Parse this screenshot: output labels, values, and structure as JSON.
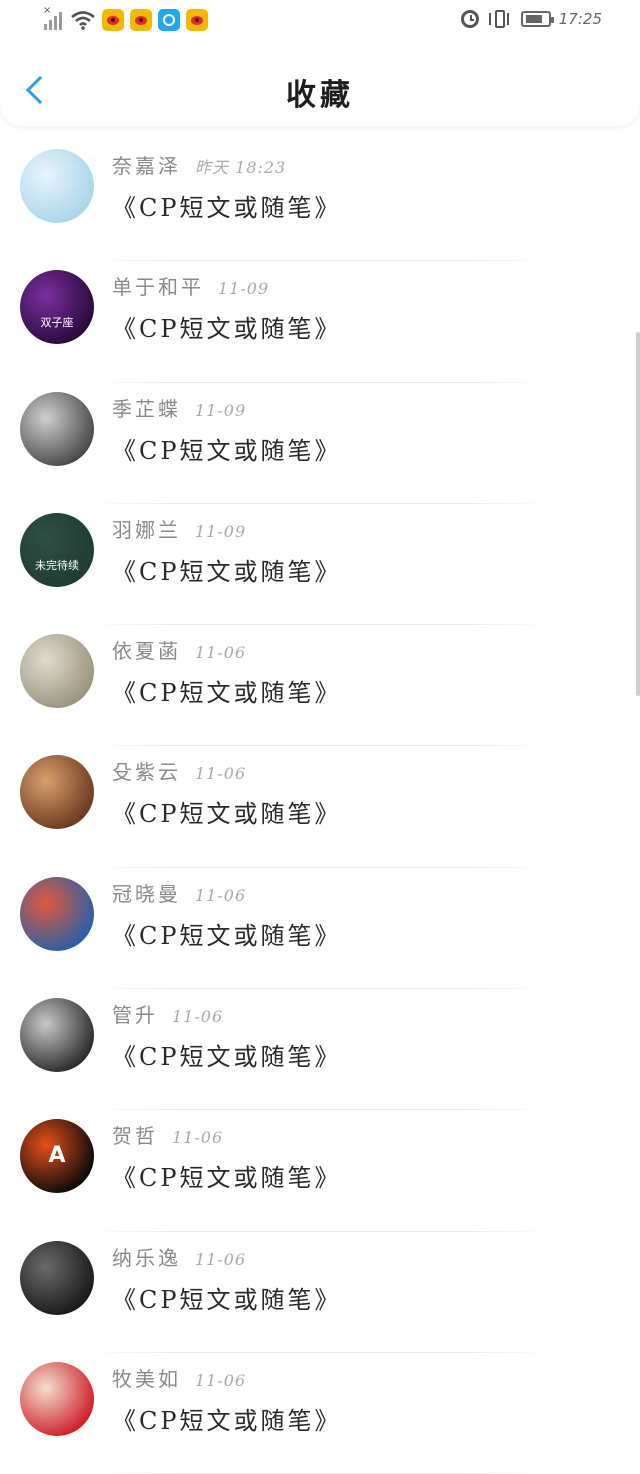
{
  "status_bar": {
    "signal_icon": "signal-x-icon",
    "wifi_icon": "wifi-icon",
    "app_icons": [
      "weibo-icon",
      "weibo-icon",
      "blue-circle-app-icon",
      "weibo-icon"
    ],
    "alarm_icon": "alarm-icon",
    "vibrate_icon": "vibrate-icon",
    "battery_icon": "battery-charging-icon",
    "time": "17:25"
  },
  "header": {
    "title": "收藏",
    "back_icon": "chevron-left-icon",
    "accent_color": "#2f9fe6"
  },
  "favorites": [
    {
      "name": "奈嘉泽",
      "time": "昨天 18:23",
      "subject": "《CP短文或随笔》",
      "avatar_colors": [
        "#a9d6ea",
        "#e9f4fa"
      ]
    },
    {
      "name": "单于和平",
      "time": "11-09",
      "subject": "《CP短文或随笔》",
      "avatar_colors": [
        "#2a0a3a",
        "#7a2fa0"
      ],
      "avatar_text": "双子座"
    },
    {
      "name": "季芷蝶",
      "time": "11-09",
      "subject": "《CP短文或随笔》",
      "avatar_colors": [
        "#4a4a4a",
        "#cfcfcf"
      ]
    },
    {
      "name": "羽娜兰",
      "time": "11-09",
      "subject": "《CP短文或随笔》",
      "avatar_colors": [
        "#1f3d33",
        "#2f4f43"
      ],
      "avatar_text": "未完待续"
    },
    {
      "name": "依夏菡",
      "time": "11-06",
      "subject": "《CP短文或随笔》",
      "avatar_colors": [
        "#9a9480",
        "#e0dccf"
      ]
    },
    {
      "name": "殳紫云",
      "time": "11-06",
      "subject": "《CP短文或随笔》",
      "avatar_colors": [
        "#6b3b22",
        "#d9a06a"
      ]
    },
    {
      "name": "冠晓曼",
      "time": "11-06",
      "subject": "《CP短文或随笔》",
      "avatar_colors": [
        "#2b5fa8",
        "#e05a3a"
      ]
    },
    {
      "name": "管升",
      "time": "11-06",
      "subject": "《CP短文或随笔》",
      "avatar_colors": [
        "#2c2c2c",
        "#c8c8c8"
      ]
    },
    {
      "name": "贺哲",
      "time": "11-06",
      "subject": "《CP短文或随笔》",
      "avatar_colors": [
        "#0a0a0a",
        "#e8501a"
      ],
      "avatar_text": "A"
    },
    {
      "name": "纳乐逸",
      "time": "11-06",
      "subject": "《CP短文或随笔》",
      "avatar_colors": [
        "#1a1a1a",
        "#6a6a6a"
      ]
    },
    {
      "name": "牧美如",
      "time": "11-06",
      "subject": "《CP短文或随笔》",
      "avatar_colors": [
        "#d0202a",
        "#f0e0d0"
      ]
    }
  ]
}
